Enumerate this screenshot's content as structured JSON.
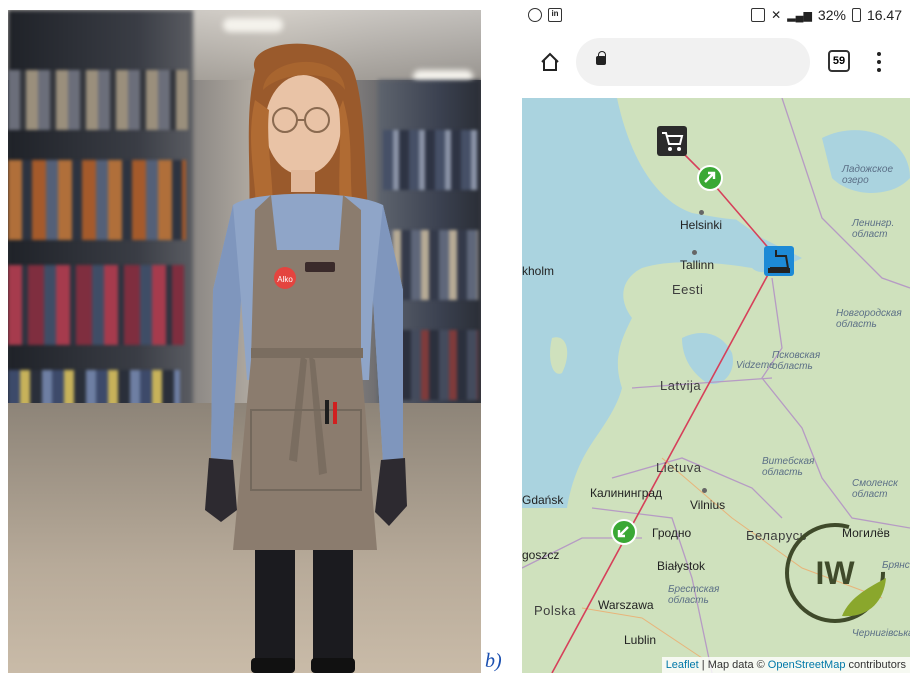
{
  "caption_suffix": "b)",
  "photo": {
    "badge_text": "Alko"
  },
  "status_bar": {
    "battery": "32%",
    "time": "16.47"
  },
  "browser": {
    "tab_count": "59"
  },
  "map": {
    "labels": {
      "helsinki": "Helsinki",
      "tallinn": "Tallinn",
      "stockholm": "kholm",
      "eesti": "Eesti",
      "latvija": "Latvija",
      "lietuva": "Lietuva",
      "vidzeme": "Vidzeme",
      "kaliningrad": "Калининград",
      "gdansk": "Gdańsk",
      "vilnius": "Vilnius",
      "grodno": "Гродно",
      "belarus": "Беларусь",
      "bialystok": "Białystok",
      "brest": "Брестская область",
      "polska": "Polska",
      "warszawa": "Warszawa",
      "lublin": "Lublin",
      "goszcz": "goszcz",
      "ladoga": "Ладожское озеро",
      "leningrad": "Ленингр. област",
      "novgorod": "Новгородская область",
      "pskov": "Псковская область",
      "vitebsk": "Витебская область",
      "smolensk": "Смоленск област",
      "mogilev": "Могилёв",
      "chernigov": "Чернигівська",
      "bryansk": "Брянс"
    },
    "attribution": {
      "leaflet": "Leaflet",
      "text": "| Map data ©",
      "osm": "OpenStreetMap",
      "contributors": "contributors"
    },
    "watermark": "IW",
    "colors": {
      "route": "#d6405a",
      "sea": "#aad3df",
      "land": "#cfe1bd",
      "marker_green": "#3aa835",
      "marker_blue": "#1d8ad6"
    }
  }
}
